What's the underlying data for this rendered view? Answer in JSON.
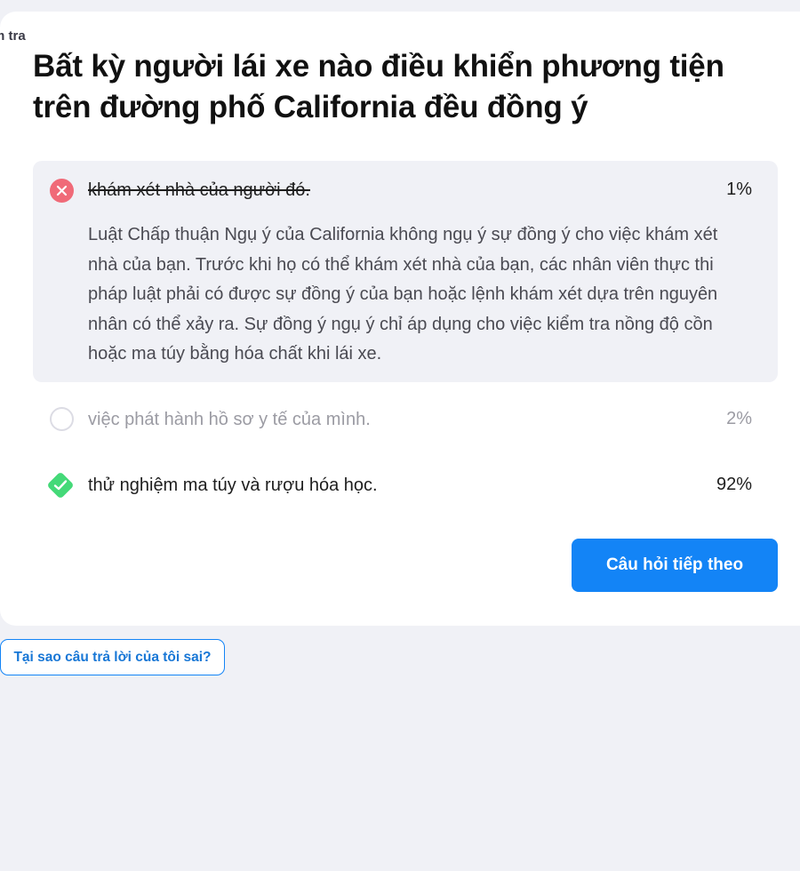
{
  "header": {
    "crumb": "m tra"
  },
  "question": {
    "text": "Bất kỳ người lái xe nào điều khiển phương tiện trên đường phố California đều đồng ý"
  },
  "answers": [
    {
      "text": "khám xét nhà của người đó.",
      "percent": "1%",
      "state": "wrong-selected",
      "explanation": "Luật Chấp thuận Ngụ ý của California không ngụ ý sự đồng ý cho việc khám xét nhà của bạn. Trước khi họ có thể khám xét nhà của bạn, các nhân viên thực thi pháp luật phải có được sự đồng ý của bạn hoặc lệnh khám xét dựa trên nguyên nhân có thể xảy ra. Sự đồng ý ngụ ý chỉ áp dụng cho việc kiểm tra nồng độ cồn hoặc ma túy bằng hóa chất khi lái xe."
    },
    {
      "text": "việc phát hành hồ sơ y tế của mình.",
      "percent": "2%",
      "state": "unselected"
    },
    {
      "text": "thử nghiệm ma túy và rượu hóa học.",
      "percent": "92%",
      "state": "correct"
    }
  ],
  "buttons": {
    "next": "Câu hỏi tiếp theo",
    "why": "Tại sao câu trả lời của tôi sai?"
  },
  "colors": {
    "background": "#f0f1f6",
    "card": "#ffffff",
    "wrong": "#f06a78",
    "correct": "#44d978",
    "primary": "#1384f6"
  },
  "icons": {
    "wrong": "x-circle-icon",
    "empty": "empty-circle-icon",
    "correct": "check-diamond-icon"
  }
}
